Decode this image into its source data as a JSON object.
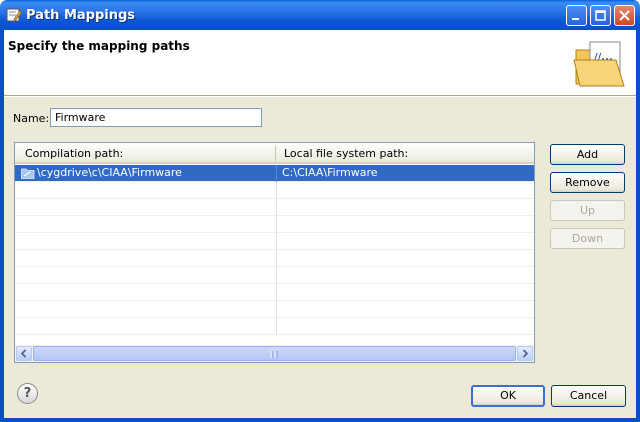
{
  "window": {
    "title": "Path Mappings",
    "banner_title": "Specify the mapping paths"
  },
  "form": {
    "name_label": "Name:",
    "name_value": "Firmware"
  },
  "table": {
    "columns": [
      "Compilation path:",
      "Local file system path:"
    ],
    "rows": [
      {
        "compilation": "\\cygdrive\\c\\CIAA\\Firmware",
        "local": "C:\\CIAA\\Firmware",
        "selected": true
      }
    ]
  },
  "buttons": {
    "add": "Add",
    "remove": "Remove",
    "up": "Up",
    "down": "Down",
    "ok": "OK",
    "cancel": "Cancel"
  },
  "icons": {
    "title": "edit-window-icon",
    "banner": "folder-path-icon",
    "row": "folder-link-icon",
    "help": "help-icon"
  },
  "colors": {
    "titlebar": "#0a4fc6",
    "selection": "#316ac5",
    "dialog_bg": "#ece9d8"
  }
}
